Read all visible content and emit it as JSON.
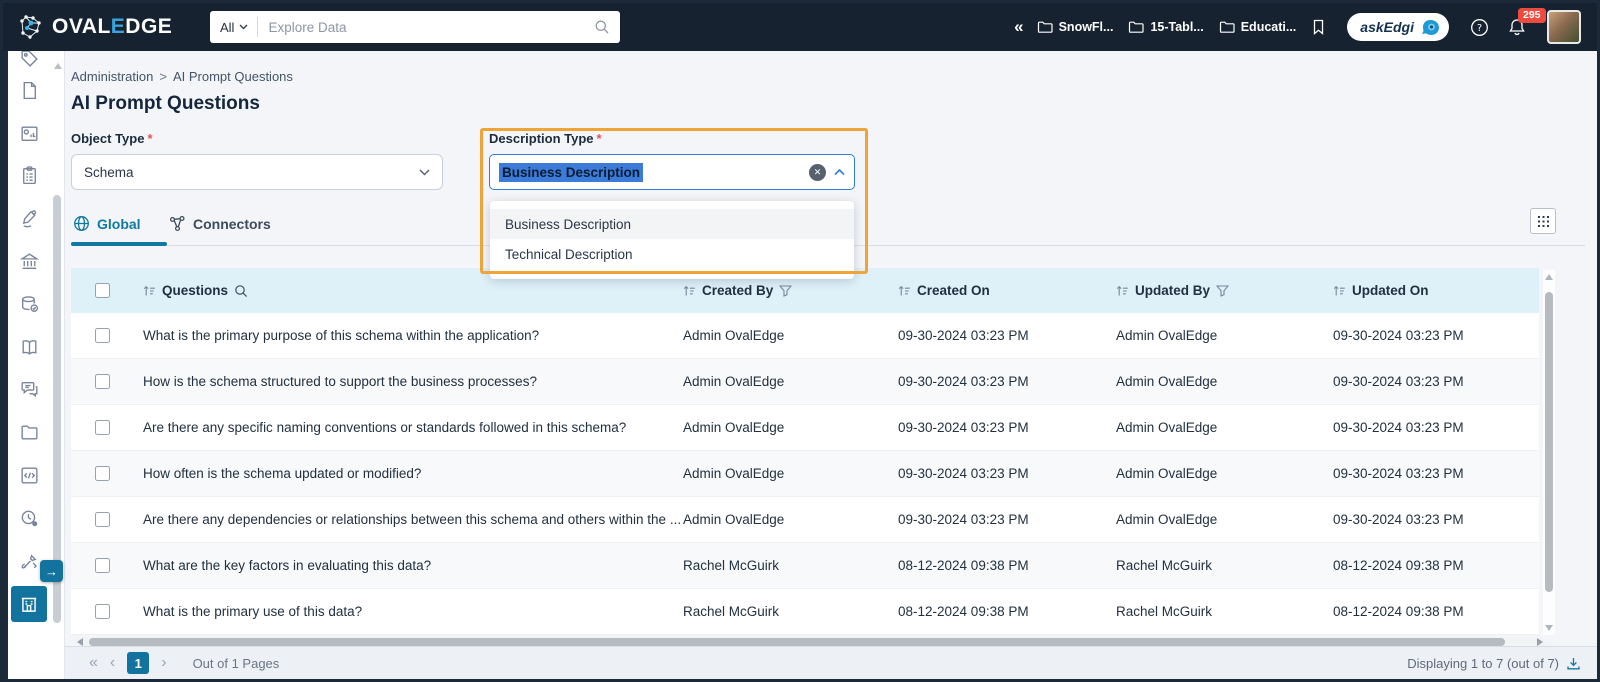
{
  "navbar": {
    "brand": {
      "name": "OvalEdge",
      "word_left": "OVAL",
      "word_e": "E",
      "word_right": "DGE"
    },
    "search": {
      "scope": "All",
      "placeholder": "Explore Data"
    },
    "pinned_tabs": [
      "SnowFl...",
      "15-Tabl...",
      "Educati..."
    ],
    "askedgi_label": "askEdgi",
    "notification_count": "295"
  },
  "sidebar": {
    "icons": [
      "tag",
      "file",
      "report",
      "clipboard",
      "data-quality",
      "governance",
      "database-check",
      "glossary-book",
      "chat",
      "folder",
      "code",
      "scheduler",
      "tools",
      "administration-building"
    ],
    "active_item": "administration"
  },
  "page": {
    "breadcrumb": {
      "part1": "Administration",
      "separator": ">",
      "part2": "AI Prompt Questions"
    },
    "title": "AI Prompt Questions",
    "object_type": {
      "label": "Object Type",
      "required": "*",
      "value": "Schema"
    },
    "description_type": {
      "label": "Description Type",
      "required": "*",
      "value": "Business Description",
      "options": [
        "Business Description",
        "Technical Description"
      ]
    },
    "tabs": {
      "global": "Global",
      "connectors": "Connectors"
    }
  },
  "table": {
    "headers": {
      "questions": "Questions",
      "created_by": "Created By",
      "created_on": "Created On",
      "updated_by": "Updated By",
      "updated_on": "Updated On"
    },
    "rows": [
      {
        "question": "What is the primary purpose of this schema within the application?",
        "created_by": "Admin OvalEdge",
        "created_on": "09-30-2024 03:23 PM",
        "updated_by": "Admin OvalEdge",
        "updated_on": "09-30-2024 03:23 PM"
      },
      {
        "question": "How is the schema structured to support the business processes?",
        "created_by": "Admin OvalEdge",
        "created_on": "09-30-2024 03:23 PM",
        "updated_by": "Admin OvalEdge",
        "updated_on": "09-30-2024 03:23 PM"
      },
      {
        "question": "Are there any specific naming conventions or standards followed in this schema?",
        "created_by": "Admin OvalEdge",
        "created_on": "09-30-2024 03:23 PM",
        "updated_by": "Admin OvalEdge",
        "updated_on": "09-30-2024 03:23 PM"
      },
      {
        "question": "How often is the schema updated or modified?",
        "created_by": "Admin OvalEdge",
        "created_on": "09-30-2024 03:23 PM",
        "updated_by": "Admin OvalEdge",
        "updated_on": "09-30-2024 03:23 PM"
      },
      {
        "question": "Are there any dependencies or relationships between this schema and others within the ...",
        "created_by": "Admin OvalEdge",
        "created_on": "09-30-2024 03:23 PM",
        "updated_by": "Admin OvalEdge",
        "updated_on": "09-30-2024 03:23 PM"
      },
      {
        "question": "What are the key factors in evaluating this data?",
        "created_by": "Rachel McGuirk",
        "created_on": "08-12-2024 09:38 PM",
        "updated_by": "Rachel McGuirk",
        "updated_on": "08-12-2024 09:38 PM"
      },
      {
        "question": "What is the primary use of this data?",
        "created_by": "Rachel McGuirk",
        "created_on": "08-12-2024 09:38 PM",
        "updated_by": "Rachel McGuirk",
        "updated_on": "08-12-2024 09:38 PM"
      }
    ]
  },
  "footer": {
    "current_page": "1",
    "pages_text": "Out of 1 Pages",
    "displaying_text": "Displaying 1 to 7 (out of 7)"
  },
  "colors": {
    "navbar_bg": "#16222f",
    "accent_teal": "#1179a1",
    "annotation_orange": "#f0a438",
    "selection_blue": "#3d7bd9",
    "table_header_bg": "#def0f8",
    "notification_badge": "#ee4b40",
    "focus_border": "#2f7fd6"
  }
}
